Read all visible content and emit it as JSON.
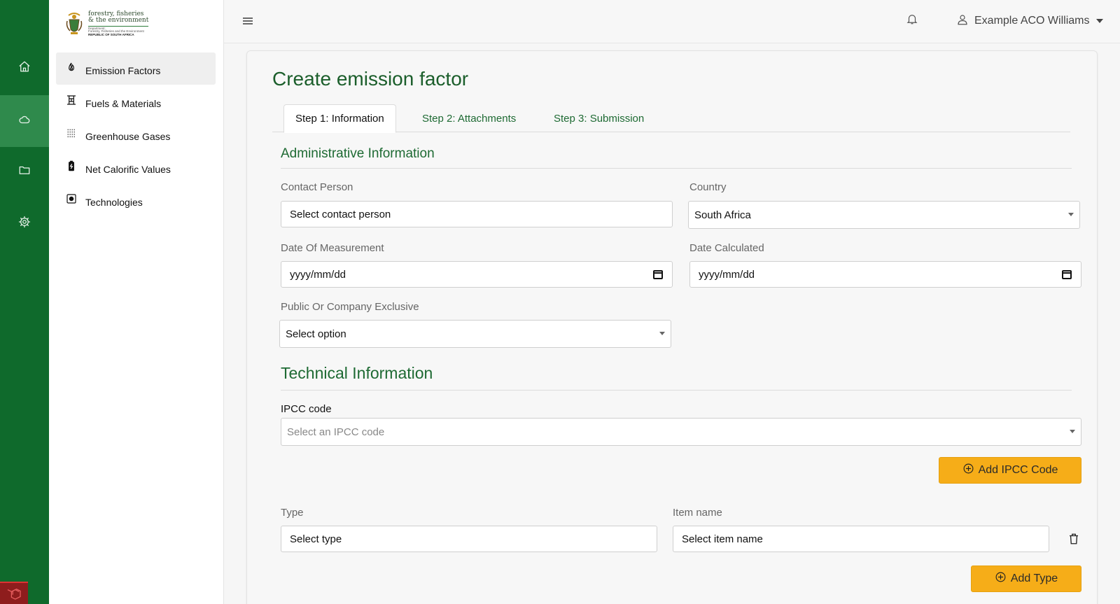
{
  "brand": {
    "line1": "forestry, fisheries",
    "line2": "& the environment",
    "line3": "Department:",
    "line4": "Forestry, Fisheries and the Environment",
    "line5": "REPUBLIC OF SOUTH AFRICA"
  },
  "rail": {
    "items": [
      {
        "icon": "home-icon"
      },
      {
        "icon": "cloud-icon",
        "active": true
      },
      {
        "icon": "folder-icon"
      },
      {
        "icon": "gear-icon"
      }
    ]
  },
  "sidebar": {
    "items": [
      {
        "label": "Emission Factors",
        "icon": "flame-icon",
        "active": true
      },
      {
        "label": "Fuels & Materials",
        "icon": "fuel-icon"
      },
      {
        "label": "Greenhouse Gases",
        "icon": "grid-dots-icon"
      },
      {
        "label": "Net Calorific Values",
        "icon": "battery-icon"
      },
      {
        "label": "Technologies",
        "icon": "chip-icon"
      }
    ]
  },
  "header": {
    "user_name": "Example ACO Williams"
  },
  "main": {
    "title": "Create emission factor",
    "tabs": [
      {
        "label": "Step 1: Information",
        "active": true
      },
      {
        "label": "Step 2: Attachments"
      },
      {
        "label": "Step 3: Submission"
      }
    ],
    "admin": {
      "title": "Administrative Information",
      "contact_person": {
        "label": "Contact Person",
        "value": "Select contact person"
      },
      "country": {
        "label": "Country",
        "value": "South Africa"
      },
      "date_measurement": {
        "label": "Date Of Measurement",
        "value": "yyyy/mm/dd"
      },
      "date_calculated": {
        "label": "Date Calculated",
        "value": "yyyy/mm/dd"
      },
      "public_company": {
        "label": "Public Or Company Exclusive",
        "value": "Select option"
      }
    },
    "technical": {
      "title": "Technical Information",
      "ipcc": {
        "label": "IPCC code",
        "placeholder": "Select an IPCC code"
      },
      "add_ipcc_label": "Add IPCC Code",
      "type": {
        "label": "Type",
        "value": "Select type"
      },
      "item_name": {
        "label": "Item name",
        "value": "Select item name"
      },
      "add_type_label": "Add Type"
    }
  },
  "colors": {
    "rail": "#0f6a2c",
    "rail_active": "#2f8a4c",
    "accent_green": "#1e6a33",
    "button_yellow": "#f6ad18"
  }
}
